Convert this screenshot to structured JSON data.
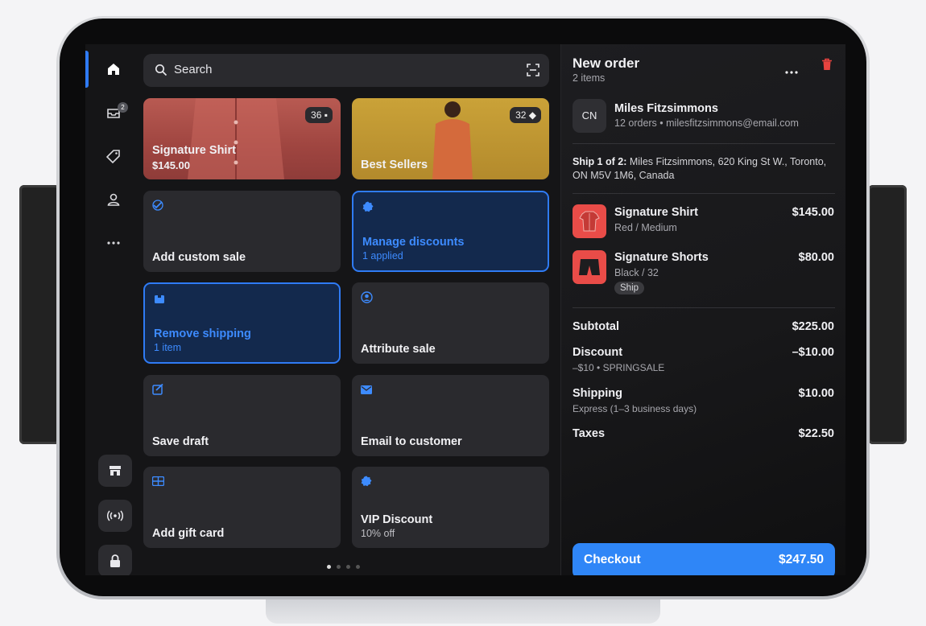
{
  "search": {
    "placeholder": "Search"
  },
  "rail": {
    "badge": "2"
  },
  "tiles": [
    {
      "title": "Signature Shirt",
      "subtitle": "$145.00",
      "count": "36"
    },
    {
      "title": "Best Sellers",
      "count": "32"
    },
    {
      "title": "Add custom sale"
    },
    {
      "title": "Manage discounts",
      "subtitle": "1 applied"
    },
    {
      "title": "Remove shipping",
      "subtitle": "1 item"
    },
    {
      "title": "Attribute sale"
    },
    {
      "title": "Save draft"
    },
    {
      "title": "Email to customer"
    },
    {
      "title": "Add gift card"
    },
    {
      "title": "VIP Discount",
      "subtitle": "10% off"
    }
  ],
  "order": {
    "title": "New order",
    "items_count": "2 items",
    "customer": {
      "initials": "CN",
      "name": "Miles Fitzsimmons",
      "details": "12 orders • milesfitzsimmons@email.com"
    },
    "ship_label": "Ship 1 of 2:",
    "ship_address": "Miles Fitzsimmons, 620 King St W., Toronto, ON M5V 1M6, Canada",
    "line_items": [
      {
        "name": "Signature Shirt",
        "variant": "Red / Medium",
        "price": "$145.00"
      },
      {
        "name": "Signature Shorts",
        "variant": "Black / 32",
        "price": "$80.00",
        "tag": "Ship"
      }
    ],
    "subtotal": {
      "label": "Subtotal",
      "value": "$225.00"
    },
    "discount": {
      "label": "Discount",
      "value": "–$10.00",
      "detail": "–$10 • SPRINGSALE"
    },
    "shipping": {
      "label": "Shipping",
      "value": "$10.00",
      "detail": "Express (1–3 business days)"
    },
    "taxes": {
      "label": "Taxes",
      "value": "$22.50"
    },
    "checkout": {
      "label": "Checkout",
      "total": "$247.50"
    }
  },
  "colors": {
    "accent": "#2f7bf5",
    "delete": "#e8433f",
    "checkout": "#2f86f7"
  }
}
